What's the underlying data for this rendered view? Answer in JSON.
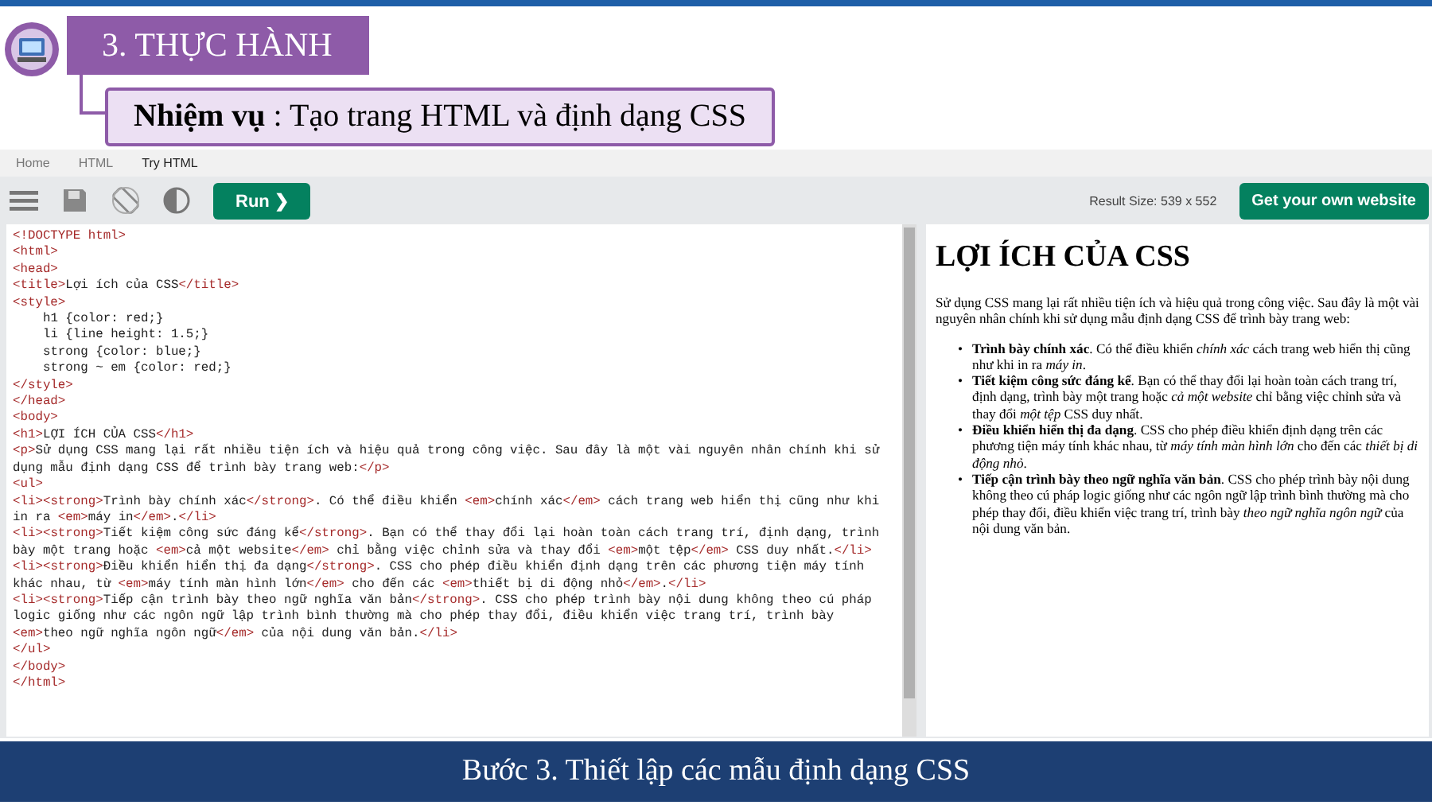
{
  "slide": {
    "section_title": "3. THỰC HÀNH",
    "task": "**Nhiệm vụ** : Tạo trang HTML và định dạng CSS",
    "footer": "Bước 3. Thiết lập các mẫu định dạng CSS"
  },
  "breadcrumb": [
    {
      "label": "Home",
      "selected": false
    },
    {
      "label": "HTML",
      "selected": false
    },
    {
      "label": "Try HTML",
      "selected": true
    }
  ],
  "toolbar": {
    "run_label": "Run ❯",
    "result_size": "Result Size: 539 x 552",
    "cta": "Get your own website"
  },
  "editor": {
    "lines": [
      "<!DOCTYPE html>",
      "<html>",
      "<head>",
      "<title>Lợi ích của CSS</title>",
      "<style>",
      "    h1 {color: red;}",
      "    li {line height: 1.5;}",
      "    strong {color: blue;}",
      "    strong ~ em {color: red;}",
      "</style>",
      "</head>",
      "<body>",
      "<h1>LỢI ÍCH CỦA CSS</h1>",
      "<p>Sử dụng CSS mang lại rất nhiều tiện ích và hiệu quả trong công việc. Sau đây là một vài nguyên nhân chính khi sử dụng mẫu định dạng CSS để trình bày trang web:</p>",
      "<ul>",
      "<li><strong>Trình bày chính xác</strong>. Có thể điều khiển <em>chính xác</em> cách trang web hiển thị cũng như khi in ra <em>máy in</em>.</li>",
      "<li><strong>Tiết kiệm công sức đáng kể</strong>. Bạn có thể thay đổi lại hoàn toàn cách trang trí, định dạng, trình bày một trang hoặc <em>cả một website</em> chỉ bằng việc chỉnh sửa và thay đổi <em>một tệp</em> CSS duy nhất.</li>",
      "<li><strong>Điều khiển hiển thị đa dạng</strong>. CSS cho phép điều khiển định dạng trên các phương tiện máy tính khác nhau, từ <em>máy tính màn hình lớn</em> cho đến các <em>thiết bị di động nhỏ</em>.</li>",
      "<li><strong>Tiếp cận trình bày theo ngữ nghĩa văn bản</strong>. CSS cho phép trình bày nội dung không theo cú pháp logic giống như các ngôn ngữ lập trình bình thường mà cho phép thay đổi, điều khiển việc trang trí, trình bày <em>theo ngữ nghĩa ngôn ngữ</em> của nội dung văn bản.</li>",
      "</ul>",
      "</body>",
      "</html>"
    ]
  },
  "result": {
    "heading": "LỢI ÍCH CỦA CSS",
    "paragraph": "Sử dụng CSS mang lại rất nhiều tiện ích và hiệu quả trong công việc. Sau đây là một vài nguyên nhân chính khi sử dụng mẫu định dạng CSS để trình bày trang web:",
    "items": [
      {
        "bullet": "•",
        "text": "**Trình bày chính xác**. Có thể điều khiển *chính xác* cách trang web hiển thị cũng như khi in ra *máy in*."
      },
      {
        "bullet": "•",
        "text": "**Tiết kiệm công sức đáng kể**. Bạn có thể thay đổi lại hoàn toàn cách trang trí, định dạng, trình bày một trang hoặc *cả một website* chỉ bằng việc chỉnh sửa và thay đổi *một tệp* CSS duy nhất."
      },
      {
        "bullet": "•",
        "text": "**Điều khiển hiển thị đa dạng**. CSS cho phép điều khiển định dạng trên các phương tiện máy tính khác nhau, từ *máy tính màn hình lớn* cho đến các *thiết bị di động nhỏ*."
      },
      {
        "bullet": "•",
        "text": "**Tiếp cận trình bày theo ngữ nghĩa văn bản**. CSS cho phép trình bày nội dung không theo cú pháp logic giống như các ngôn ngữ lập trình bình thường mà cho phép thay đổi, điều khiển việc trang trí, trình bày *theo ngữ nghĩa ngôn ngữ* của nội dung văn bản."
      }
    ]
  }
}
